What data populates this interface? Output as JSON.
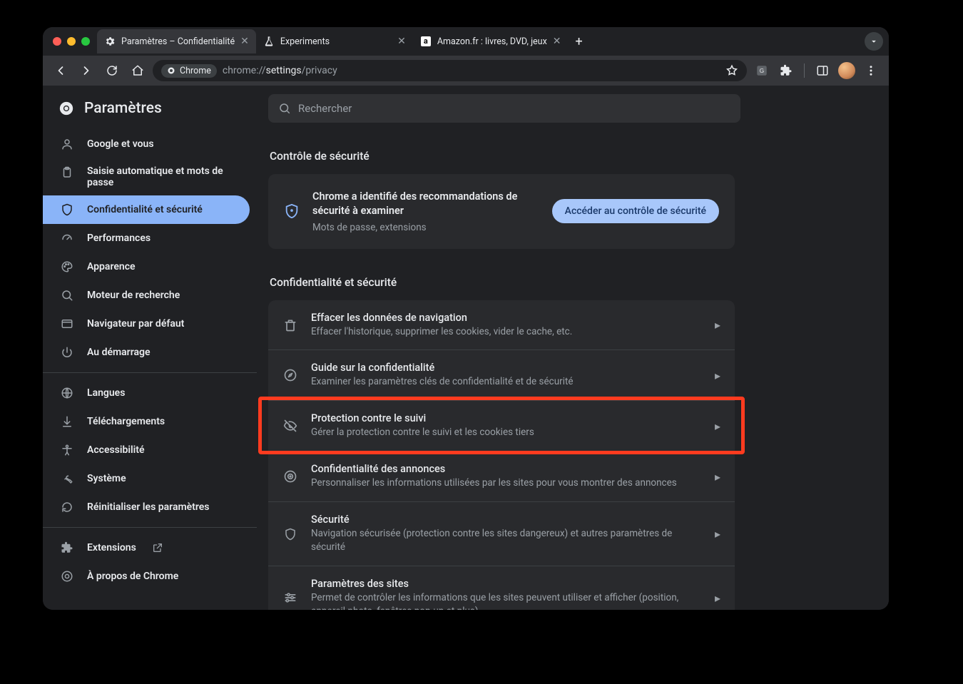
{
  "tabs": [
    {
      "title": "Paramètres – Confidentialité",
      "icon": "gear"
    },
    {
      "title": "Experiments",
      "icon": "flask"
    },
    {
      "title": "Amazon.fr : livres, DVD, jeux",
      "icon": "amazon"
    }
  ],
  "omnibox": {
    "chip": "Chrome",
    "url_prefix": "chrome://",
    "url_mid": "settings",
    "url_suffix": "/privacy"
  },
  "brand": "Paramètres",
  "nav": [
    {
      "label": "Google et vous",
      "icon": "person"
    },
    {
      "label": "Saisie automatique et mots de passe",
      "icon": "clipboard"
    },
    {
      "label": "Confidentialité et sécurité",
      "icon": "shield",
      "active": true
    },
    {
      "label": "Performances",
      "icon": "speed"
    },
    {
      "label": "Apparence",
      "icon": "palette"
    },
    {
      "label": "Moteur de recherche",
      "icon": "search"
    },
    {
      "label": "Navigateur par défaut",
      "icon": "browser"
    },
    {
      "label": "Au démarrage",
      "icon": "power"
    }
  ],
  "nav2": [
    {
      "label": "Langues",
      "icon": "globe"
    },
    {
      "label": "Téléchargements",
      "icon": "download"
    },
    {
      "label": "Accessibilité",
      "icon": "a11y"
    },
    {
      "label": "Système",
      "icon": "wrench"
    },
    {
      "label": "Réinitialiser les paramètres",
      "icon": "reset"
    }
  ],
  "nav3": [
    {
      "label": "Extensions",
      "icon": "puzzle",
      "external": true
    },
    {
      "label": "À propos de Chrome",
      "icon": "chrome"
    }
  ],
  "search_placeholder": "Rechercher",
  "section_safety_title": "Contrôle de sécurité",
  "safety": {
    "title": "Chrome a identifié des recommandations de sécurité à examiner",
    "subtitle": "Mots de passe, extensions",
    "button": "Accéder au contrôle de sécurité"
  },
  "section_privacy_title": "Confidentialité et sécurité",
  "rows": [
    {
      "title": "Effacer les données de navigation",
      "sub": "Effacer l'historique, supprimer les cookies, vider le cache, etc.",
      "icon": "trash"
    },
    {
      "title": "Guide sur la confidentialité",
      "sub": "Examiner les paramètres clés de confidentialité et de sécurité",
      "icon": "compass"
    },
    {
      "title": "Protection contre le suivi",
      "sub": "Gérer la protection contre le suivi et les cookies tiers",
      "icon": "eye-off"
    },
    {
      "title": "Confidentialité des annonces",
      "sub": "Personnaliser les informations utilisées par les sites pour vous montrer des annonces",
      "icon": "ads"
    },
    {
      "title": "Sécurité",
      "sub": "Navigation sécurisée (protection contre les sites dangereux) et autres paramètres de sécurité",
      "icon": "shield"
    },
    {
      "title": "Paramètres des sites",
      "sub": "Permet de contrôler les informations que les sites peuvent utiliser et afficher (position, appareil photo, fenêtres pop-up et plus)",
      "icon": "tune"
    }
  ],
  "highlight_row_index": 2
}
